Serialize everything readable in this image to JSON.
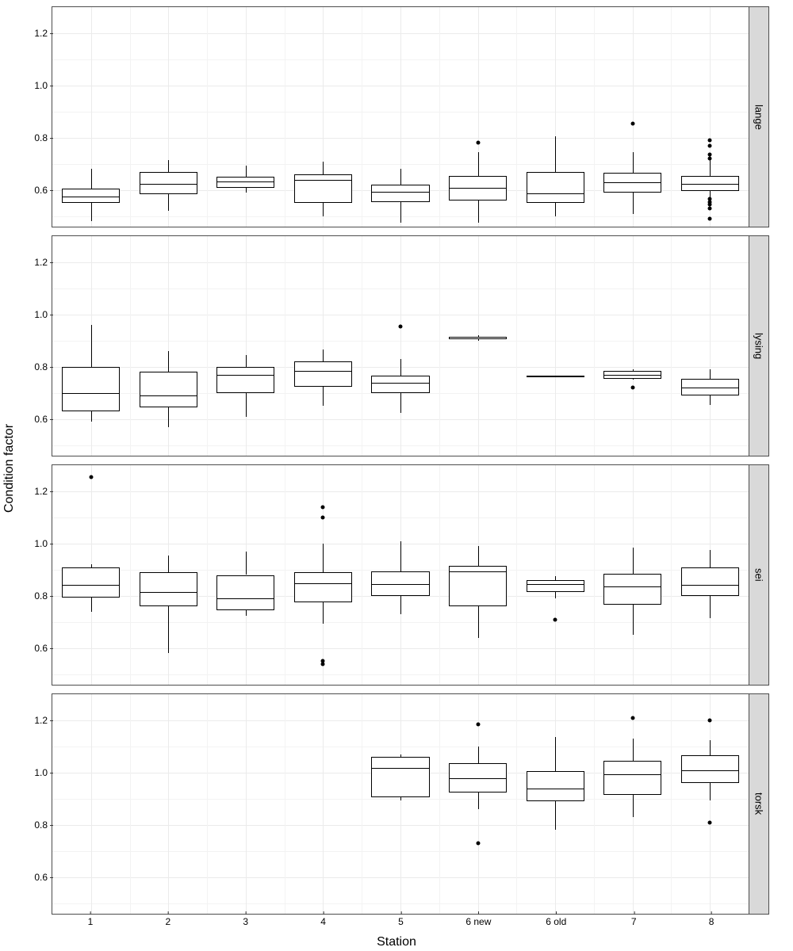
{
  "xlabel": "Station",
  "ylabel": "Condition factor",
  "y_ticks": [
    0.6,
    0.8,
    1.0,
    1.2
  ],
  "y_range": [
    0.46,
    1.3
  ],
  "categories": [
    "1",
    "2",
    "3",
    "4",
    "5",
    "6 new",
    "6 old",
    "7",
    "8"
  ],
  "facets": [
    "lange",
    "lysing",
    "sei",
    "torsk"
  ],
  "chart_data": [
    {
      "facet": "lange",
      "type": "box",
      "boxes": [
        {
          "cat": "1",
          "min": 0.48,
          "q1": 0.55,
          "med": 0.575,
          "q3": 0.605,
          "max": 0.68,
          "outliers": []
        },
        {
          "cat": "2",
          "min": 0.52,
          "q1": 0.585,
          "med": 0.625,
          "q3": 0.67,
          "max": 0.715,
          "outliers": []
        },
        {
          "cat": "3",
          "min": 0.59,
          "q1": 0.61,
          "med": 0.635,
          "q3": 0.65,
          "max": 0.695,
          "outliers": []
        },
        {
          "cat": "4",
          "min": 0.5,
          "q1": 0.55,
          "med": 0.64,
          "q3": 0.66,
          "max": 0.71,
          "outliers": []
        },
        {
          "cat": "5",
          "min": 0.475,
          "q1": 0.555,
          "med": 0.595,
          "q3": 0.62,
          "max": 0.68,
          "outliers": []
        },
        {
          "cat": "6 new",
          "min": 0.475,
          "q1": 0.56,
          "med": 0.61,
          "q3": 0.655,
          "max": 0.745,
          "outliers": [
            0.78
          ]
        },
        {
          "cat": "6 old",
          "min": 0.5,
          "q1": 0.55,
          "med": 0.585,
          "q3": 0.67,
          "max": 0.805,
          "outliers": []
        },
        {
          "cat": "7",
          "min": 0.51,
          "q1": 0.59,
          "med": 0.63,
          "q3": 0.665,
          "max": 0.745,
          "outliers": [
            0.855
          ]
        },
        {
          "cat": "8",
          "min": 0.55,
          "q1": 0.595,
          "med": 0.625,
          "q3": 0.655,
          "max": 0.73,
          "outliers": [
            0.49,
            0.53,
            0.545,
            0.555,
            0.565,
            0.72,
            0.735,
            0.77,
            0.79
          ]
        }
      ]
    },
    {
      "facet": "lysing",
      "type": "box",
      "boxes": [
        {
          "cat": "1",
          "min": 0.59,
          "q1": 0.63,
          "med": 0.7,
          "q3": 0.8,
          "max": 0.96,
          "outliers": []
        },
        {
          "cat": "2",
          "min": 0.57,
          "q1": 0.645,
          "med": 0.69,
          "q3": 0.78,
          "max": 0.86,
          "outliers": []
        },
        {
          "cat": "3",
          "min": 0.61,
          "q1": 0.7,
          "med": 0.77,
          "q3": 0.8,
          "max": 0.845,
          "outliers": []
        },
        {
          "cat": "4",
          "min": 0.65,
          "q1": 0.725,
          "med": 0.785,
          "q3": 0.82,
          "max": 0.865,
          "outliers": []
        },
        {
          "cat": "5",
          "min": 0.625,
          "q1": 0.7,
          "med": 0.74,
          "q3": 0.765,
          "max": 0.83,
          "outliers": [
            0.955
          ]
        },
        {
          "cat": "6 new",
          "min": 0.9,
          "q1": 0.905,
          "med": 0.91,
          "q3": 0.915,
          "max": 0.92,
          "outliers": []
        },
        {
          "cat": "6 old",
          "min": 0.76,
          "q1": 0.76,
          "med": 0.76,
          "q3": 0.765,
          "max": 0.765,
          "outliers": []
        },
        {
          "cat": "7",
          "min": 0.75,
          "q1": 0.755,
          "med": 0.77,
          "q3": 0.785,
          "max": 0.79,
          "outliers": [
            0.72
          ]
        },
        {
          "cat": "8",
          "min": 0.655,
          "q1": 0.69,
          "med": 0.72,
          "q3": 0.755,
          "max": 0.79,
          "outliers": []
        }
      ]
    },
    {
      "facet": "sei",
      "type": "box",
      "boxes": [
        {
          "cat": "1",
          "min": 0.74,
          "q1": 0.795,
          "med": 0.84,
          "q3": 0.91,
          "max": 0.92,
          "outliers": [
            1.255
          ]
        },
        {
          "cat": "2",
          "min": 0.58,
          "q1": 0.76,
          "med": 0.815,
          "q3": 0.89,
          "max": 0.955,
          "outliers": []
        },
        {
          "cat": "3",
          "min": 0.725,
          "q1": 0.745,
          "med": 0.79,
          "q3": 0.88,
          "max": 0.97,
          "outliers": []
        },
        {
          "cat": "4",
          "min": 0.695,
          "q1": 0.775,
          "med": 0.85,
          "q3": 0.89,
          "max": 1.0,
          "outliers": [
            0.54,
            0.55,
            1.1,
            1.14
          ]
        },
        {
          "cat": "5",
          "min": 0.73,
          "q1": 0.8,
          "med": 0.845,
          "q3": 0.895,
          "max": 1.01,
          "outliers": []
        },
        {
          "cat": "6 new",
          "min": 0.64,
          "q1": 0.76,
          "med": 0.895,
          "q3": 0.915,
          "max": 0.99,
          "outliers": []
        },
        {
          "cat": "6 old",
          "min": 0.79,
          "q1": 0.815,
          "med": 0.845,
          "q3": 0.86,
          "max": 0.875,
          "outliers": [
            0.71
          ]
        },
        {
          "cat": "7",
          "min": 0.65,
          "q1": 0.765,
          "med": 0.835,
          "q3": 0.885,
          "max": 0.985,
          "outliers": []
        },
        {
          "cat": "8",
          "min": 0.715,
          "q1": 0.8,
          "med": 0.84,
          "q3": 0.91,
          "max": 0.975,
          "outliers": []
        }
      ]
    },
    {
      "facet": "torsk",
      "type": "box",
      "boxes": [
        {
          "cat": "5",
          "min": 0.895,
          "q1": 0.905,
          "med": 1.02,
          "q3": 1.06,
          "max": 1.07,
          "outliers": []
        },
        {
          "cat": "6 new",
          "min": 0.86,
          "q1": 0.925,
          "med": 0.98,
          "q3": 1.035,
          "max": 1.1,
          "outliers": [
            0.73,
            1.185
          ]
        },
        {
          "cat": "6 old",
          "min": 0.78,
          "q1": 0.89,
          "med": 0.94,
          "q3": 1.005,
          "max": 1.135,
          "outliers": []
        },
        {
          "cat": "7",
          "min": 0.83,
          "q1": 0.915,
          "med": 0.995,
          "q3": 1.045,
          "max": 1.13,
          "outliers": [
            1.21
          ]
        },
        {
          "cat": "8",
          "min": 0.895,
          "q1": 0.96,
          "med": 1.01,
          "q3": 1.065,
          "max": 1.125,
          "outliers": [
            0.81,
            1.2
          ]
        }
      ]
    }
  ]
}
